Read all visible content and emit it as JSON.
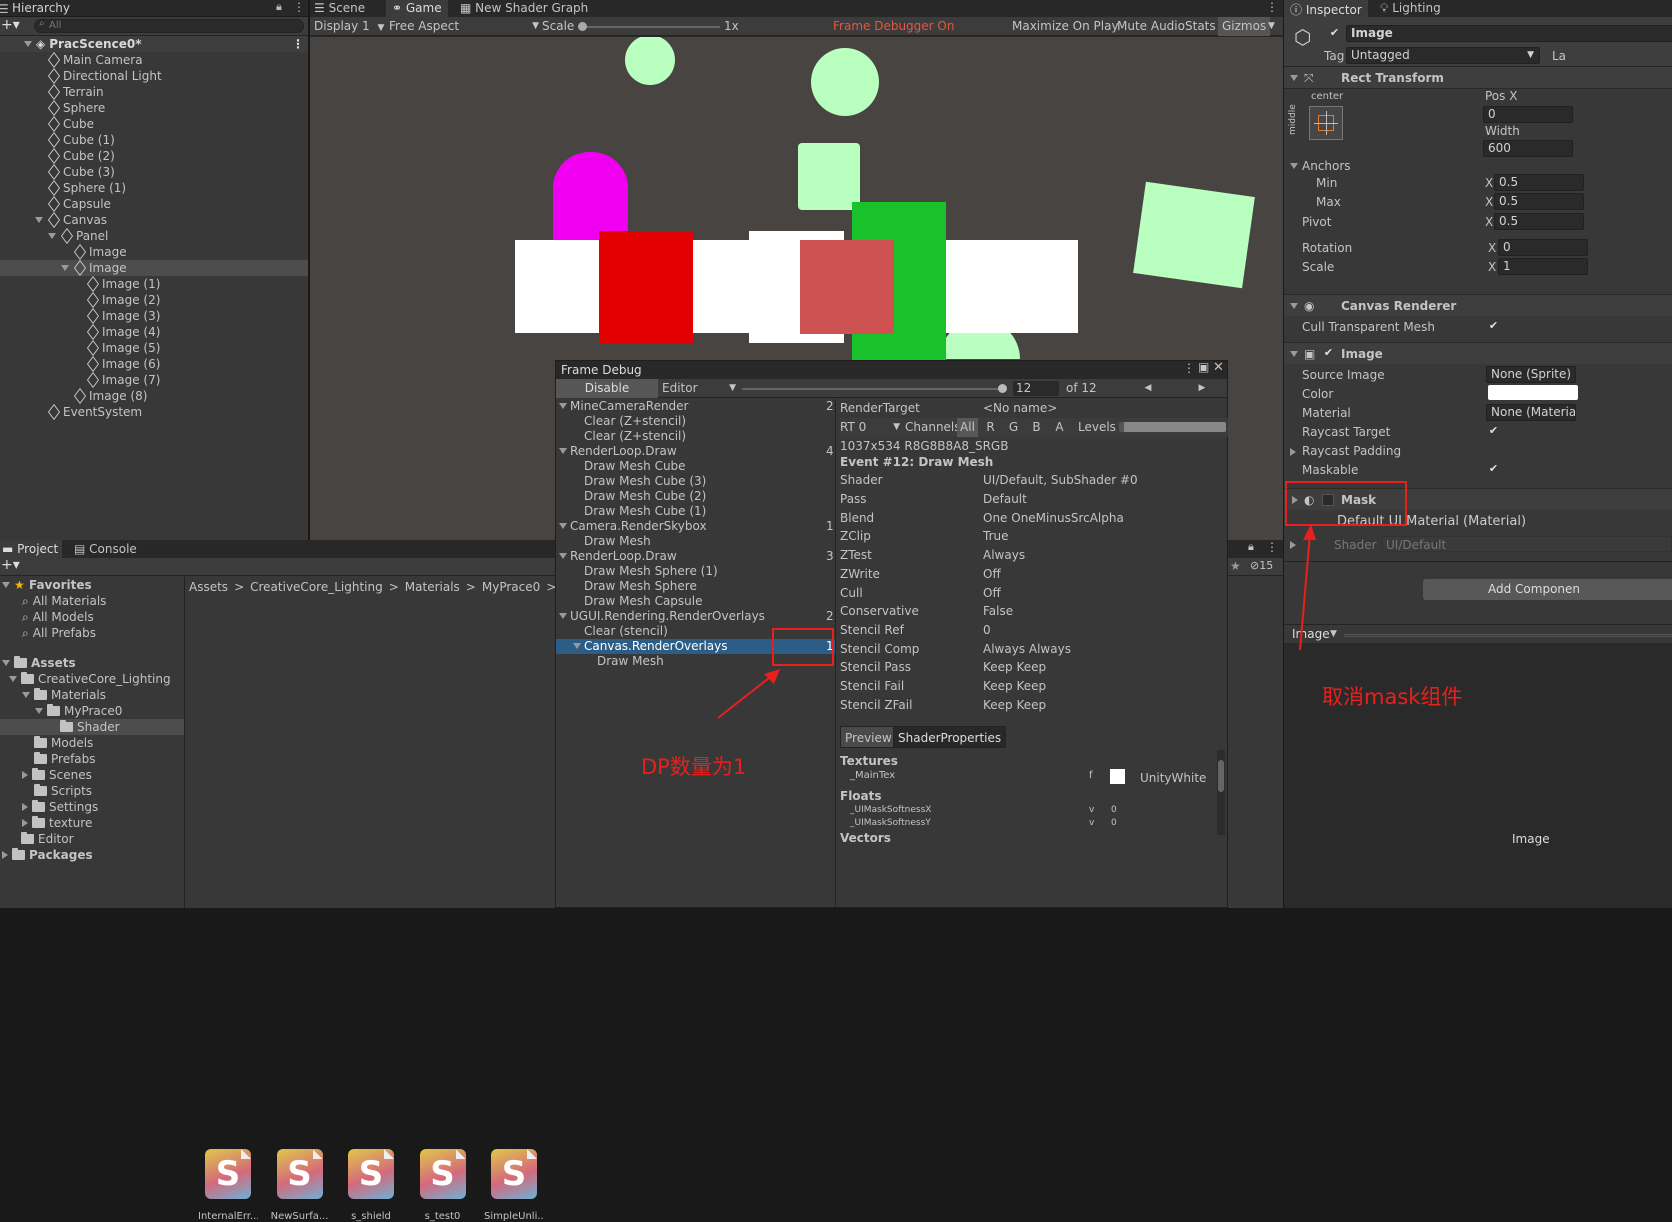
{
  "hierarchy": {
    "tab": "Hierarchy",
    "search_placeholder": "All",
    "scene": "PracScence0*",
    "items": [
      {
        "label": "Main Camera",
        "depth": 1
      },
      {
        "label": "Directional Light",
        "depth": 1
      },
      {
        "label": "Terrain",
        "depth": 1
      },
      {
        "label": "Sphere",
        "depth": 1
      },
      {
        "label": "Cube",
        "depth": 1
      },
      {
        "label": "Cube (1)",
        "depth": 1
      },
      {
        "label": "Cube (2)",
        "depth": 1
      },
      {
        "label": "Cube (3)",
        "depth": 1
      },
      {
        "label": "Sphere (1)",
        "depth": 1
      },
      {
        "label": "Capsule",
        "depth": 1
      },
      {
        "label": "Canvas",
        "depth": 1
      },
      {
        "label": "Panel",
        "depth": 2
      },
      {
        "label": "Image",
        "depth": 3
      },
      {
        "label": "Image",
        "depth": 3
      },
      {
        "label": "Image (1)",
        "depth": 4
      },
      {
        "label": "Image (2)",
        "depth": 4
      },
      {
        "label": "Image (3)",
        "depth": 4
      },
      {
        "label": "Image (4)",
        "depth": 4
      },
      {
        "label": "Image (5)",
        "depth": 4
      },
      {
        "label": "Image (6)",
        "depth": 4
      },
      {
        "label": "Image (7)",
        "depth": 4
      },
      {
        "label": "Image (8)",
        "depth": 3
      },
      {
        "label": "EventSystem",
        "depth": 1
      }
    ]
  },
  "view_tabs": {
    "scene": "Scene",
    "game": "Game",
    "shader_graph": "New Shader Graph"
  },
  "game_toolbar": {
    "display": "Display 1",
    "aspect": "Free Aspect",
    "scale_label": "Scale",
    "scale_value": "1x",
    "frame_debugger": "Frame Debugger On",
    "maximize": "Maximize On Play",
    "mute": "Mute Audio",
    "stats": "Stats",
    "gizmos": "Gizmos"
  },
  "frame_debug": {
    "title": "Frame Debug",
    "disable": "Disable",
    "target": "Editor",
    "event_index": "12",
    "event_total": "of 12",
    "tree": [
      {
        "label": "MineCameraRender",
        "count": "2",
        "indent": 0,
        "expanded": true
      },
      {
        "label": "Clear (Z+stencil)",
        "count": "",
        "indent": 2
      },
      {
        "label": "Clear (Z+stencil)",
        "count": "",
        "indent": 2
      },
      {
        "label": "RenderLoop.Draw",
        "count": "4",
        "indent": 0,
        "expanded": true
      },
      {
        "label": "Draw Mesh Cube",
        "count": "",
        "indent": 2
      },
      {
        "label": "Draw Mesh Cube (3)",
        "count": "",
        "indent": 2
      },
      {
        "label": "Draw Mesh Cube (2)",
        "count": "",
        "indent": 2
      },
      {
        "label": "Draw Mesh Cube (1)",
        "count": "",
        "indent": 2
      },
      {
        "label": "Camera.RenderSkybox",
        "count": "1",
        "indent": 0,
        "expanded": true
      },
      {
        "label": "Draw Mesh",
        "count": "",
        "indent": 2
      },
      {
        "label": "RenderLoop.Draw",
        "count": "3",
        "indent": 0,
        "expanded": true
      },
      {
        "label": "Draw Mesh Sphere (1)",
        "count": "",
        "indent": 2
      },
      {
        "label": "Draw Mesh Sphere",
        "count": "",
        "indent": 2
      },
      {
        "label": "Draw Mesh Capsule",
        "count": "",
        "indent": 2
      },
      {
        "label": "UGUI.Rendering.RenderOverlays",
        "count": "2",
        "indent": 0,
        "expanded": true
      },
      {
        "label": "Clear (stencil)",
        "count": "",
        "indent": 2
      },
      {
        "label": "Canvas.RenderOverlays",
        "count": "1",
        "indent": 2,
        "expanded": true,
        "selected": true
      },
      {
        "label": "Draw Mesh",
        "count": "",
        "indent": 3
      }
    ],
    "render_target_label": "RenderTarget",
    "render_target_value": "<No name>",
    "rt": "RT 0",
    "channels_label": "Channels",
    "channels": [
      "All",
      "R",
      "G",
      "B",
      "A"
    ],
    "levels_label": "Levels",
    "format": "1037x534 R8G8B8A8_SRGB",
    "event_title": "Event #12: Draw Mesh",
    "props": [
      {
        "k": "Shader",
        "v": "UI/Default, SubShader #0"
      },
      {
        "k": "Pass",
        "v": "Default"
      },
      {
        "k": "Blend",
        "v": "One OneMinusSrcAlpha"
      },
      {
        "k": "ZClip",
        "v": "True"
      },
      {
        "k": "ZTest",
        "v": "Always"
      },
      {
        "k": "ZWrite",
        "v": "Off"
      },
      {
        "k": "Cull",
        "v": "Off"
      },
      {
        "k": "Conservative",
        "v": "False"
      },
      {
        "k": "Stencil Ref",
        "v": "0"
      },
      {
        "k": "Stencil Comp",
        "v": "Always Always"
      },
      {
        "k": "Stencil Pass",
        "v": "Keep Keep"
      },
      {
        "k": "Stencil Fail",
        "v": "Keep Keep"
      },
      {
        "k": "Stencil ZFail",
        "v": "Keep Keep"
      }
    ],
    "preview_tab": "Preview",
    "shader_props_tab": "ShaderProperties",
    "textures_label": "Textures",
    "tex_name": "_MainTex",
    "tex_flag": "f",
    "tex_value": "UnityWhite",
    "floats_label": "Floats",
    "floats": [
      {
        "name": "_UIMaskSoftnessX",
        "flag": "v",
        "value": "0"
      },
      {
        "name": "_UIMaskSoftnessY",
        "flag": "v",
        "value": "0"
      }
    ],
    "vectors_label": "Vectors"
  },
  "annotations": {
    "dp": "DP数量为1",
    "mask": "取消mask组件"
  },
  "project": {
    "tab_project": "Project",
    "tab_console": "Console",
    "hidden_count": "15",
    "favorites": "Favorites",
    "fav_items": [
      "All Materials",
      "All Models",
      "All Prefabs"
    ],
    "assets_label": "Assets",
    "tree": [
      {
        "label": "CreativeCore_Lighting",
        "indent": 1,
        "open": true
      },
      {
        "label": "Materials",
        "indent": 2,
        "open": true
      },
      {
        "label": "MyPrace0",
        "indent": 3,
        "open": true
      },
      {
        "label": "Shader",
        "indent": 4,
        "selected": true
      },
      {
        "label": "Models",
        "indent": 2
      },
      {
        "label": "Prefabs",
        "indent": 2
      },
      {
        "label": "Scenes",
        "indent": 2,
        "collapsed": true
      },
      {
        "label": "Scripts",
        "indent": 2
      },
      {
        "label": "Settings",
        "indent": 2,
        "collapsed": true
      },
      {
        "label": "texture",
        "indent": 2,
        "collapsed": true
      },
      {
        "label": "Editor",
        "indent": 1
      }
    ],
    "packages": "Packages",
    "breadcrumb": [
      "Assets",
      "CreativeCore_Lighting",
      "Materials",
      "MyPrace0",
      "Shader"
    ],
    "assets": [
      "InternalErr...",
      "NewSurfa...",
      "s_shield",
      "s_test0",
      "SimpleUnli..."
    ],
    "asset_letter": "S"
  },
  "inspector": {
    "tab_inspector": "Inspector",
    "tab_lighting": "Lighting",
    "object_name": "Image",
    "tag_label": "Tag",
    "tag_value": "Untagged",
    "layer_label": "La",
    "rect_transform": "Rect Transform",
    "center": "center",
    "middle": "middle",
    "posx_label": "Pos X",
    "posx": "0",
    "width_label": "Width",
    "width": "600",
    "anchors": "Anchors",
    "min": "Min",
    "max": "Max",
    "pivot": "Pivot",
    "rotation": "Rotation",
    "scale": "Scale",
    "x_label": "X",
    "anchor_min_x": "0.5",
    "anchor_max_x": "0.5",
    "pivot_x": "0.5",
    "rotation_x": "0",
    "scale_x": "1",
    "canvas_renderer": "Canvas Renderer",
    "cull": "Cull Transparent Mesh",
    "image_comp": "Image",
    "source_image": "Source Image",
    "source_image_value": "None (Sprite)",
    "color": "Color",
    "material": "Material",
    "material_value": "None (Material",
    "raycast_target": "Raycast Target",
    "raycast_padding": "Raycast Padding",
    "maskable": "Maskable",
    "mask": "Mask",
    "default_material": "Default UI Material (Material)",
    "shader_label": "Shader",
    "shader_value": "UI/Default",
    "add_component": "Add Componen",
    "preview_label": "Image",
    "bottom_label": "Image"
  }
}
